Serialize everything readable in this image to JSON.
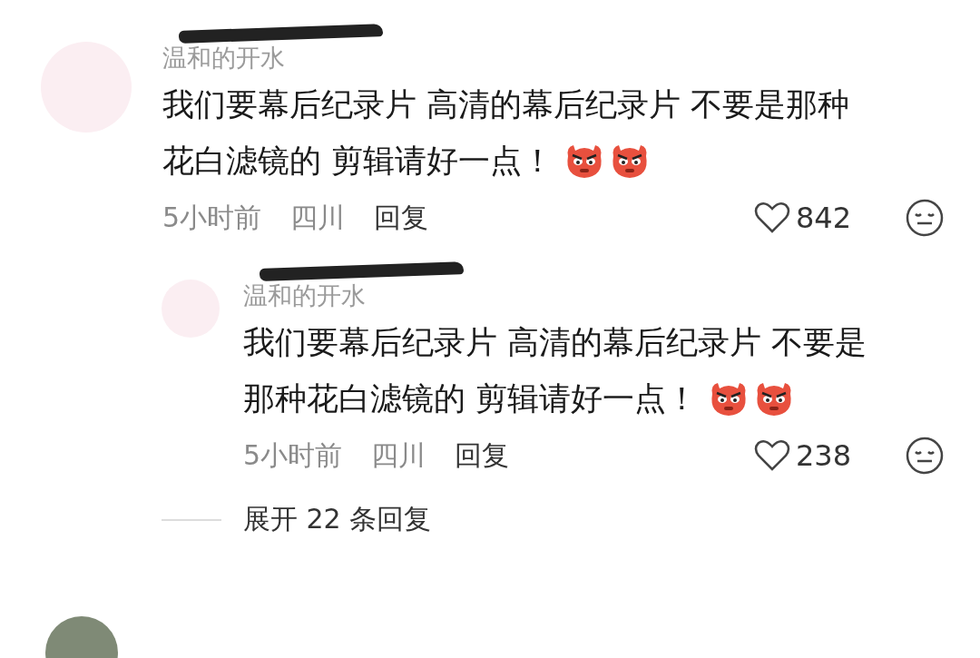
{
  "comments": [
    {
      "username": "温和的开水",
      "redacted": true,
      "text_lines": [
        "我们要幕后纪录片 高清的幕后纪录片 不要是那种",
        "花白滤镜的 剪辑请好一点！"
      ],
      "emojis": [
        {
          "kind": "angry"
        },
        {
          "kind": "angry"
        }
      ],
      "time": "5小时前",
      "location": "四川",
      "reply_label": "回复",
      "likes": "842",
      "replies": [
        {
          "username": "温和的开水",
          "redacted": true,
          "text_lines": [
            "我们要幕后纪录片 高清的幕后纪录片 不要是",
            "那种花白滤镜的 剪辑请好一点！"
          ],
          "emojis": [
            {
              "kind": "angry"
            },
            {
              "kind": "angry"
            }
          ],
          "time": "5小时前",
          "location": "四川",
          "reply_label": "回复",
          "likes": "238"
        }
      ],
      "expand_label": "展开 22 条回复"
    }
  ]
}
